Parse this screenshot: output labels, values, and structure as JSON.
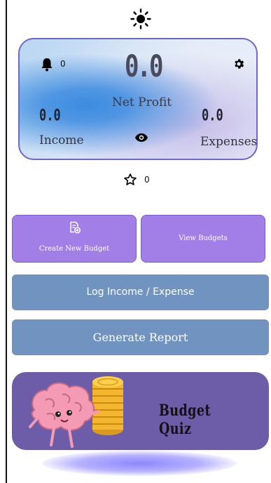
{
  "header": {
    "theme_icon": "sun-icon"
  },
  "card": {
    "notification_count": "0",
    "net_profit_value": "0.0",
    "net_profit_label": "Net Profit",
    "income_value": "0.0",
    "income_label": "Income",
    "expenses_value": "0.0",
    "expenses_label": "Expenses",
    "icons": [
      "bell-icon",
      "gear-icon",
      "eye-icon"
    ]
  },
  "favorites": {
    "star_count": "0",
    "icon": "star-icon"
  },
  "actions": {
    "create_budget_label": "Create New Budget",
    "view_budgets_label": "View Budgets",
    "log_label": "Log Income / Expense",
    "report_label": "Generate Report"
  },
  "quiz": {
    "title": "Budget Quiz"
  },
  "colors": {
    "tile_purple": "#a17fe6",
    "button_blue": "#7094bf",
    "quiz_purple": "#6d5ca8",
    "card_border": "#6f68c9"
  }
}
